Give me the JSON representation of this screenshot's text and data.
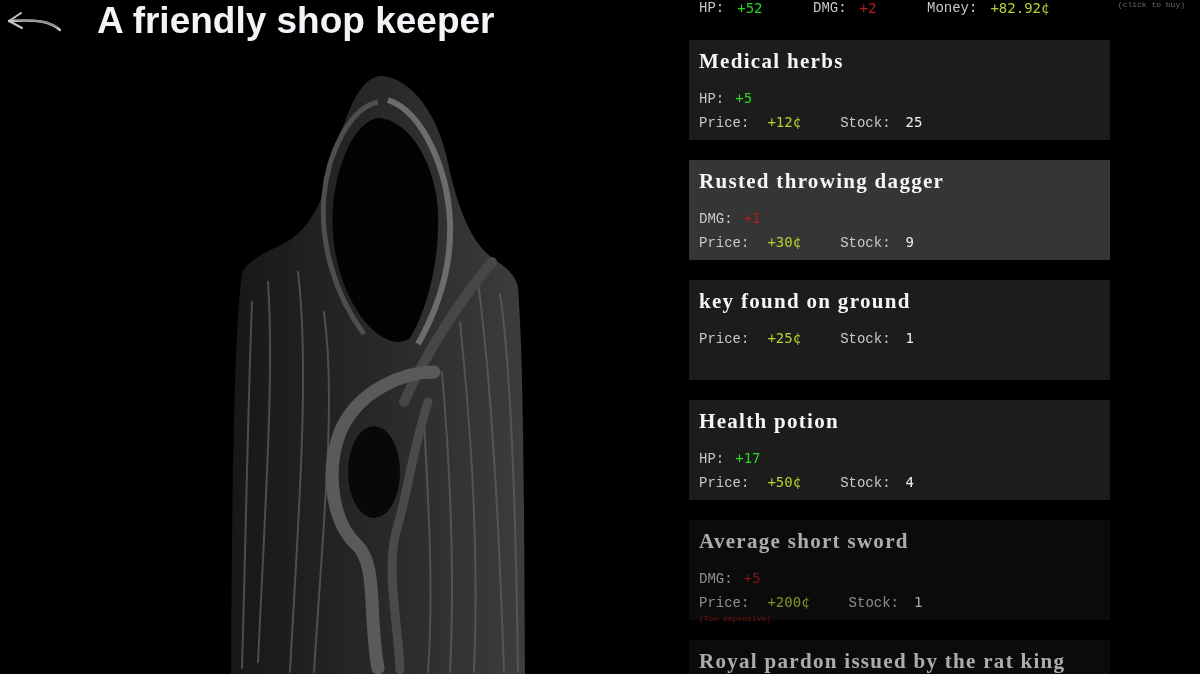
{
  "header": {
    "title": "A friendly shop keeper"
  },
  "player_stats": [
    {
      "kind": "hp",
      "label": "HP:",
      "value": "+52"
    },
    {
      "kind": "dmg",
      "label": "DMG:",
      "value": "+2"
    },
    {
      "kind": "money",
      "label": "Money:",
      "value": "+82.92¢"
    }
  ],
  "hint": "(click to buy)",
  "items": [
    {
      "name": "Medical herbs",
      "highlighted": false,
      "affordable": true,
      "effects": [
        {
          "kind": "hp",
          "label": "HP:",
          "value": "+5"
        }
      ],
      "price": {
        "label": "Price:",
        "value": "+12¢"
      },
      "stock": {
        "label": "Stock:",
        "value": "25"
      }
    },
    {
      "name": "Rusted throwing dagger",
      "highlighted": true,
      "affordable": true,
      "effects": [
        {
          "kind": "dmg",
          "label": "DMG:",
          "value": "+1"
        }
      ],
      "price": {
        "label": "Price:",
        "value": "+30¢"
      },
      "stock": {
        "label": "Stock:",
        "value": "9"
      }
    },
    {
      "name": "key found on ground",
      "highlighted": false,
      "affordable": true,
      "price": {
        "label": "Price:",
        "value": "+25¢"
      },
      "stock": {
        "label": "Stock:",
        "value": "1"
      }
    },
    {
      "name": "Health potion",
      "highlighted": false,
      "affordable": true,
      "effects": [
        {
          "kind": "hp",
          "label": "HP:",
          "value": "+17"
        }
      ],
      "price": {
        "label": "Price:",
        "value": "+50¢"
      },
      "stock": {
        "label": "Stock:",
        "value": "4"
      }
    },
    {
      "name": "Average short sword",
      "highlighted": false,
      "affordable": false,
      "effects": [
        {
          "kind": "dmg",
          "label": "DMG:",
          "value": "+5"
        }
      ],
      "price": {
        "label": "Price:",
        "value": "+200¢"
      },
      "stock": {
        "label": "Stock:",
        "value": "1"
      },
      "warning": "(Too expensive)"
    },
    {
      "name": "Royal pardon issued by the rat king",
      "highlighted": false,
      "affordable": false
    }
  ]
}
